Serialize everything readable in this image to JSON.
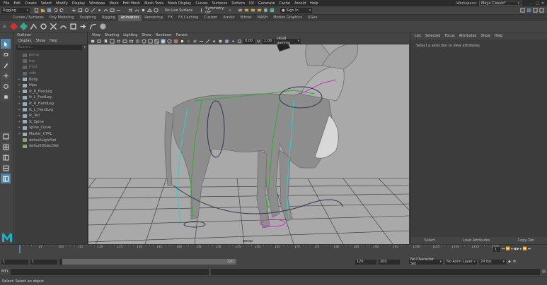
{
  "titlebar": {
    "menus": [
      "File",
      "Edit",
      "Create",
      "Select",
      "Modify",
      "Display",
      "Windows",
      "Mesh",
      "Edit Mesh",
      "Mesh Tools",
      "Mesh Display",
      "Curves",
      "Surfaces",
      "Deform",
      "UV",
      "Generate",
      "Cache",
      "Arnold",
      "Help"
    ],
    "workspace_label": "Workspace:",
    "workspace_value": "Maya Classic*",
    "window_controls": [
      "minimize",
      "maximize",
      "close"
    ]
  },
  "status_line": {
    "menuset": "Rigging",
    "no_live_surface": "No Live Surface",
    "symmetry": "Symmetry: Off",
    "sign_in": "Sign In"
  },
  "shelf_tabs": [
    "Curves / Surfaces",
    "Poly Modeling",
    "Sculpting",
    "Rigging",
    "Animation",
    "Rendering",
    "FX",
    "FX Caching",
    "Custom",
    "Arnold",
    "Bifrost",
    "MASH",
    "Motion Graphics",
    "XGen"
  ],
  "shelf_active": "Animation",
  "outliner": {
    "title": "Outliner",
    "menus": [
      "Display",
      "Show",
      "Help"
    ],
    "search_placeholder": "Search...",
    "items": [
      {
        "label": "persp",
        "dim": true
      },
      {
        "label": "top",
        "dim": true
      },
      {
        "label": "front",
        "dim": true
      },
      {
        "label": "side",
        "dim": true
      },
      {
        "label": "Body",
        "dim": false
      },
      {
        "label": "Hips",
        "dim": false
      },
      {
        "label": "ik_R_FootLeg",
        "dim": false
      },
      {
        "label": "ik_L_FootLeg",
        "dim": false
      },
      {
        "label": "ik_R_HandLeg",
        "dim": false
      },
      {
        "label": "ik_L_HandLeg",
        "dim": false
      },
      {
        "label": "ik_Tail",
        "dim": false
      },
      {
        "label": "ik_Spine",
        "dim": false
      },
      {
        "label": "Spine_Curve",
        "dim": false
      },
      {
        "label": "Master_CTRL",
        "dim": false
      },
      {
        "label": "defaultLightSet",
        "dim": false
      },
      {
        "label": "defaultObjectSet",
        "dim": false
      }
    ]
  },
  "viewport": {
    "menus": [
      "View",
      "Shading",
      "Lighting",
      "Show",
      "Renderer",
      "Panels"
    ],
    "camera_label": "persp",
    "colorspace": "sRGB gamma",
    "exposure": "0.00",
    "gamma": "1.00"
  },
  "attribute_editor": {
    "menus": [
      "List",
      "Selected",
      "Focus",
      "Attributes",
      "Show",
      "Help"
    ],
    "message": "Select a selection to view attributes",
    "tabs": [
      "Select",
      "Load Attributes",
      "Copy Tab"
    ]
  },
  "timeline": {
    "ticks": [
      "5",
      "10",
      "15",
      "20",
      "25",
      "30",
      "35",
      "40",
      "45",
      "50",
      "55",
      "60",
      "65",
      "70",
      "75",
      "80",
      "85",
      "90",
      "95",
      "100",
      "105",
      "110",
      "115",
      "120"
    ],
    "current_frame": "1"
  },
  "range_slider": {
    "start": "1",
    "inner_start": "1",
    "range_end": "120",
    "end": "120",
    "max": "200",
    "char_set": "No Character Set",
    "anim_layer": "No Anim Layer",
    "fps": "24 fps"
  },
  "command_line": {
    "label": "MEL",
    "help_text": "Select: Select an object"
  },
  "colors": {
    "highlight": "#5285a6",
    "viewport_bg": "#a9a9a9",
    "maya_logo": "#17b3c6"
  }
}
